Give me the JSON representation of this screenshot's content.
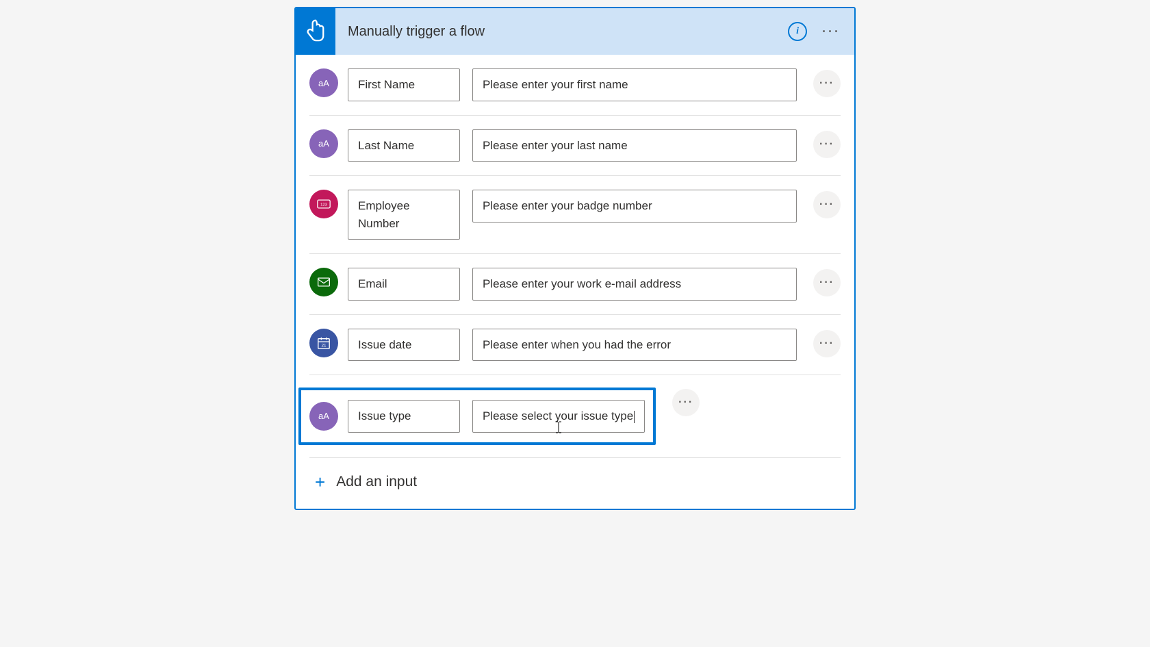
{
  "header": {
    "title": "Manually trigger a flow"
  },
  "inputs": [
    {
      "type": "text",
      "name": "First Name",
      "placeholder": "Please enter your first name"
    },
    {
      "type": "text",
      "name": "Last Name",
      "placeholder": "Please enter your last name"
    },
    {
      "type": "number",
      "name": "Employee Number",
      "placeholder": "Please enter your badge number"
    },
    {
      "type": "email",
      "name": "Email",
      "placeholder": "Please enter your work e-mail address"
    },
    {
      "type": "date",
      "name": "Issue date",
      "placeholder": "Please enter when you had the error"
    },
    {
      "type": "text",
      "name": "Issue type",
      "placeholder": "Please select your issue type",
      "highlighted": true,
      "editing": true
    }
  ],
  "addInput": {
    "label": "Add an input"
  }
}
